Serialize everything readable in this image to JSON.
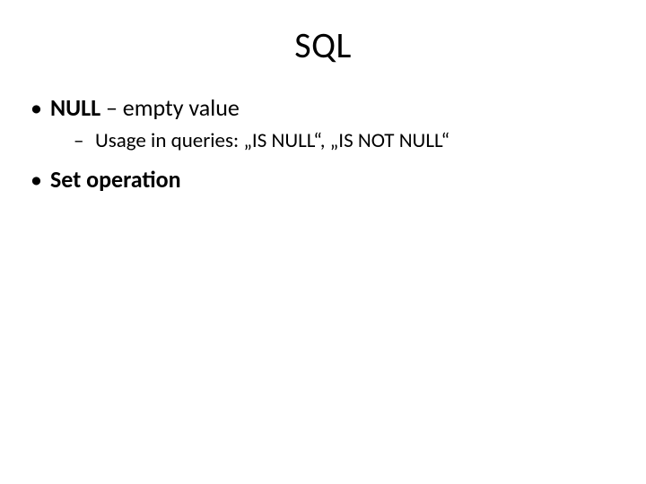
{
  "title": "SQL",
  "bullets": {
    "b1_bold": "NULL",
    "b1_rest": " – empty value",
    "b1_sub": "Usage in queries: „IS NULL“, „IS NOT NULL“",
    "b2": "Set operation"
  }
}
